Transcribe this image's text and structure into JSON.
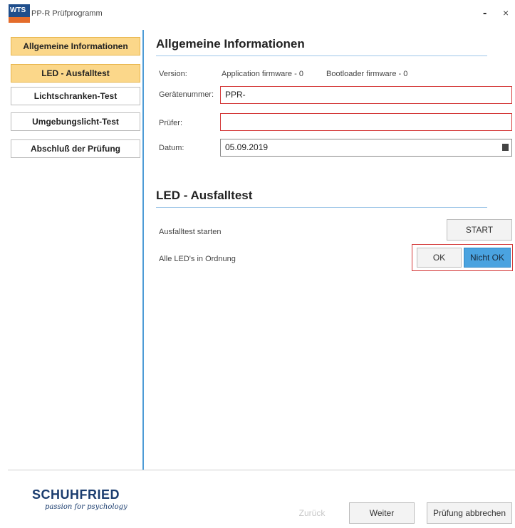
{
  "window": {
    "logo_text": "WTS",
    "title": "PP-R Prüfprogramm",
    "min_symbol": "-",
    "close_symbol": "×"
  },
  "sidebar": {
    "items": [
      {
        "label": "Allgemeine Informationen",
        "active": true
      },
      {
        "label": "LED - Ausfalltest",
        "active": true
      },
      {
        "label": "Lichtschranken-Test",
        "active": false
      },
      {
        "label": "Umgebungslicht-Test",
        "active": false
      },
      {
        "label": "Abschluß der Prüfung",
        "active": false
      }
    ]
  },
  "general": {
    "title": "Allgemeine Informationen",
    "version_label": "Version:",
    "app_fw": "Application firmware -  0",
    "boot_fw": "Bootloader firmware -  0",
    "device_label": "Gerätenummer:",
    "device_value": "PPR-",
    "tester_label": "Prüfer:",
    "tester_value": "",
    "date_label": "Datum:",
    "date_value": "05.09.2019"
  },
  "led": {
    "title": "LED - Ausfalltest",
    "start_label": "Ausfalltest starten",
    "start_button": "START",
    "status_label": "Alle LED's in Ordnung",
    "ok_button": "OK",
    "notok_button": "Nicht OK"
  },
  "footer": {
    "brand": "SCHUHFRIED",
    "tagline": "passion for psychology",
    "back_button": "Zurück",
    "next_button": "Weiter",
    "abort_button": "Prüfung abbrechen"
  },
  "colors": {
    "accent_blue": "#4d9bd6",
    "active_nav": "#fbd78a",
    "error_border": "#d43a3a",
    "brand_blue": "#1a3c6e"
  }
}
